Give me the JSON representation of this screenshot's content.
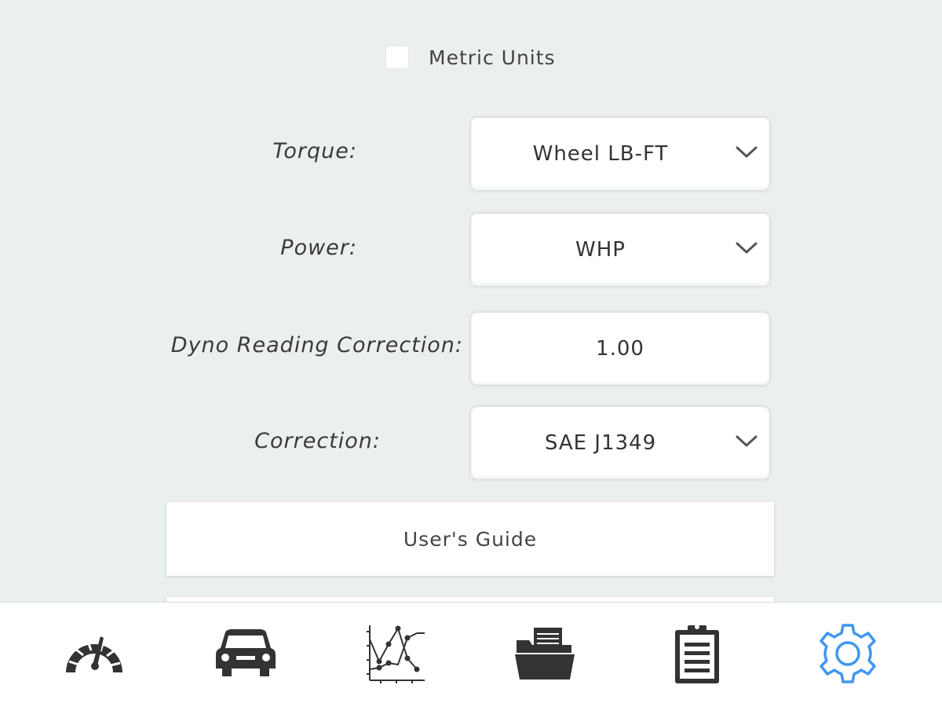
{
  "settings": {
    "metric_units_label": "Metric Units",
    "metric_units_checked": false,
    "torque": {
      "label": "Torque:",
      "value": "Wheel LB-FT"
    },
    "power": {
      "label": "Power:",
      "value": "WHP"
    },
    "dyno_correction": {
      "label": "Dyno Reading Correction:",
      "value": "1.00"
    },
    "correction": {
      "label": "Correction:",
      "value": "SAE J1349"
    },
    "users_guide_label": "User's Guide"
  },
  "tabbar": {
    "tabs": [
      {
        "icon": "gauge-icon",
        "active": false
      },
      {
        "icon": "car-icon",
        "active": false
      },
      {
        "icon": "graph-icon",
        "active": false
      },
      {
        "icon": "folder-icon",
        "active": false
      },
      {
        "icon": "clipboard-icon",
        "active": false
      },
      {
        "icon": "gear-icon",
        "active": true
      }
    ],
    "active_color": "#3f97f0",
    "icon_color": "#333333"
  }
}
